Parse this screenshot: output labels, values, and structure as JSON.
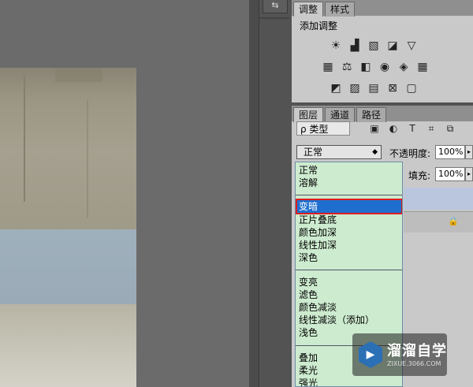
{
  "dock": {
    "button_label": "⇆"
  },
  "adjustments": {
    "tabs": [
      {
        "label": "调整"
      },
      {
        "label": "样式"
      }
    ],
    "title": "添加调整",
    "icons_row1": [
      "☀",
      "▟",
      "▧",
      "◪",
      "▽"
    ],
    "icons_row2": [
      "▦",
      "⚖",
      "◧",
      "◉",
      "◈",
      "▦"
    ],
    "icons_row3": [
      "◩",
      "▨",
      "▤",
      "⊠",
      "▢"
    ]
  },
  "layers": {
    "tabs": [
      {
        "label": "图层"
      },
      {
        "label": "通道"
      },
      {
        "label": "路径"
      }
    ],
    "filter": {
      "value": "ρ 类型"
    },
    "filter_tools": [
      "▣",
      "◐",
      "T",
      "⌗",
      "⧉"
    ],
    "blend_mode": {
      "value": "正常"
    },
    "opacity": {
      "label": "不透明度:",
      "value": "100%"
    },
    "fill": {
      "label": "填充:",
      "value": "100%"
    },
    "lock_icon": "🔒"
  },
  "blend_menu": {
    "groups": [
      [
        "正常",
        "溶解"
      ],
      [
        "变暗",
        "正片叠底",
        "颜色加深",
        "线性加深",
        "深色"
      ],
      [
        "变亮",
        "滤色",
        "颜色减淡",
        "线性减淡（添加）",
        "浅色"
      ],
      [
        "叠加",
        "柔光",
        "强光"
      ]
    ],
    "selected": "变暗"
  },
  "watermark": {
    "title": "溜溜自学",
    "subtitle": "ZIXUE.3066.COM"
  },
  "colors": {
    "menu_bg": "#cdebcf",
    "selection": "#1e6fd0",
    "highlight_border": "#e01c1c",
    "panel_bg": "#c9c9c9"
  }
}
